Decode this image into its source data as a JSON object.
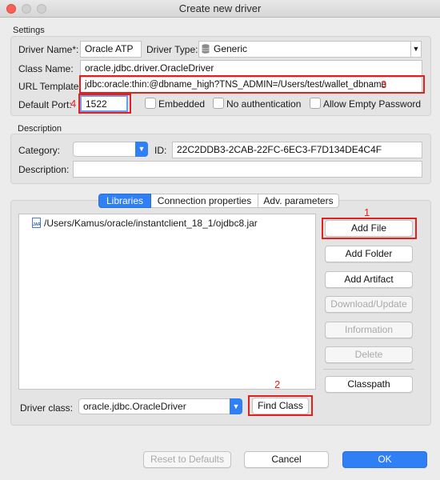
{
  "window": {
    "title": "Create new driver"
  },
  "settings": {
    "section_label": "Settings",
    "driver_name_label": "Driver Name*:",
    "driver_name_value": "Oracle ATP",
    "driver_type_label": "Driver Type:",
    "driver_type_value": "Generic",
    "class_name_label": "Class Name:",
    "class_name_value": "oracle.jdbc.driver.OracleDriver",
    "url_template_label": "URL Template:",
    "url_template_value": "jdbc:oracle:thin:@dbname_high?TNS_ADMIN=/Users/test/wallet_dbname",
    "default_port_label": "Default Port:",
    "default_port_value": "1522",
    "embedded_label": "Embedded",
    "no_auth_label": "No authentication",
    "allow_empty_password_label": "Allow Empty Password",
    "embedded_checked": false,
    "no_auth_checked": false,
    "allow_empty_password_checked": false
  },
  "description": {
    "section_label": "Description",
    "category_label": "Category:",
    "category_value": "",
    "id_label": "ID:",
    "id_value": "22C2DDB3-2CAB-22FC-6EC3-F7D134DE4C4F",
    "description_label": "Description:",
    "description_value": ""
  },
  "tabs": [
    {
      "label": "Libraries",
      "active": true
    },
    {
      "label": "Connection properties",
      "active": false
    },
    {
      "label": "Adv. parameters",
      "active": false
    }
  ],
  "libraries": {
    "items": [
      {
        "icon": "jar-file-icon",
        "path": "/Users/Kamus/oracle/instantclient_18_1/ojdbc8.jar"
      }
    ],
    "buttons": {
      "add_file": "Add File",
      "add_folder": "Add Folder",
      "add_artifact": "Add Artifact",
      "download_update": "Download/Update",
      "information": "Information",
      "delete": "Delete",
      "classpath": "Classpath"
    },
    "driver_class_label": "Driver class:",
    "driver_class_value": "oracle.jdbc.OracleDriver",
    "find_class": "Find Class"
  },
  "annotations": {
    "n1": "1",
    "n2": "2",
    "n3": "3",
    "n4": "4",
    "color": "#e0211e"
  },
  "footer": {
    "reset": "Reset to Defaults",
    "cancel": "Cancel",
    "ok": "OK"
  },
  "colors": {
    "accent": "#2f7ff5",
    "window_bg": "#ececec",
    "close": "#fc5f57"
  }
}
